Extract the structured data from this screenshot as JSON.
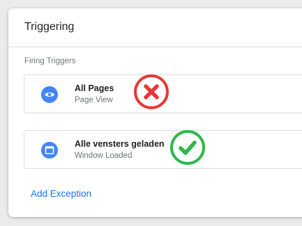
{
  "panel": {
    "title": "Triggering",
    "section_label": "Firing Triggers",
    "add_exception_label": "Add Exception"
  },
  "triggers": [
    {
      "name": "All Pages",
      "type": "Page View",
      "icon": "eye-icon",
      "status": "rejected",
      "status_icon": "red-x-icon"
    },
    {
      "name": "Alle vensters geladen",
      "type": "Window Loaded",
      "icon": "window-icon",
      "status": "approved",
      "status_icon": "green-check-icon"
    }
  ],
  "colors": {
    "accent": "#1a73e8",
    "trigger_icon_bg": "#4285f4",
    "reject": "#e53935",
    "approve": "#2db84a"
  }
}
